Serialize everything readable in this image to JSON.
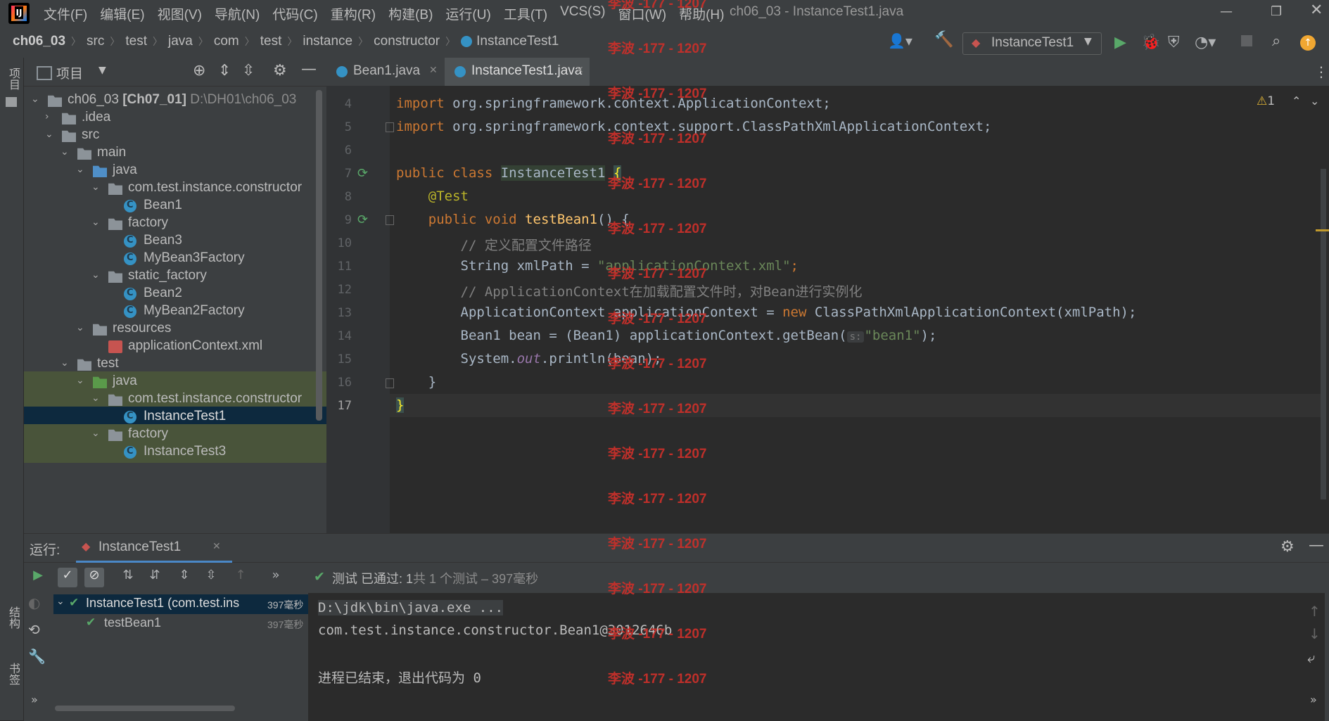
{
  "window_title": "ch06_03 - InstanceTest1.java",
  "menu": [
    "文件(F)",
    "编辑(E)",
    "视图(V)",
    "导航(N)",
    "代码(C)",
    "重构(R)",
    "构建(B)",
    "运行(U)",
    "工具(T)",
    "VCS(S)",
    "窗口(W)",
    "帮助(H)"
  ],
  "breadcrumb": [
    "ch06_03",
    "src",
    "test",
    "java",
    "com",
    "test",
    "instance",
    "constructor",
    "InstanceTest1"
  ],
  "run_config": "InstanceTest1",
  "left_strip": {
    "project": "项目",
    "structure": "结构",
    "bookmarks": "书签"
  },
  "project_panel": {
    "title": "项目"
  },
  "tree": [
    {
      "label": "ch06_03",
      "bold": "[Ch07_01]",
      "path": "D:\\DH01\\ch06_03"
    },
    {
      "label": ".idea"
    },
    {
      "label": "src"
    },
    {
      "label": "main"
    },
    {
      "label": "java"
    },
    {
      "label": "com.test.instance.constructor"
    },
    {
      "label": "Bean1"
    },
    {
      "label": "factory"
    },
    {
      "label": "Bean3"
    },
    {
      "label": "MyBean3Factory"
    },
    {
      "label": "static_factory"
    },
    {
      "label": "Bean2"
    },
    {
      "label": "MyBean2Factory"
    },
    {
      "label": "resources"
    },
    {
      "label": "applicationContext.xml"
    },
    {
      "label": "test"
    },
    {
      "label": "java"
    },
    {
      "label": "com.test.instance.constructor"
    },
    {
      "label": "InstanceTest1"
    },
    {
      "label": "factory"
    },
    {
      "label": "InstanceTest3"
    }
  ],
  "tabs": [
    {
      "label": "Bean1.java"
    },
    {
      "label": "InstanceTest1.java"
    }
  ],
  "warning_count": "1",
  "line_numbers": [
    "4",
    "5",
    "6",
    "7",
    "8",
    "9",
    "10",
    "11",
    "12",
    "13",
    "14",
    "15",
    "16",
    "17"
  ],
  "code": {
    "l4_kw": "import",
    "l4_rest": " org.springframework.context.ApplicationContext;",
    "l5_kw": "import",
    "l5_rest": " org.springframework.context.support.ClassPathXmlApplicationContext;",
    "l7_kw": "public class",
    "l7_cls": "InstanceTest1",
    "l7_brace": "{",
    "l8_ann": "@Test",
    "l9_kw": "public void",
    "l9_fn": "testBean1",
    "l9_rest": "() {",
    "l10": "// 定义配置文件路径",
    "l11_a": "String xmlPath = ",
    "l11_str": "\"applicationContext.xml\"",
    "l11_b": ";",
    "l12": "// ApplicationContext在加载配置文件时，对Bean进行实例化",
    "l13_a": "ApplicationContext applicationContext = ",
    "l13_kw": "new",
    "l13_b": " ClassPathXmlApplicationContext(xmlPath);",
    "l14_a": "Bean1 bean = (Bean1) applicationContext.getBean(",
    "l14_hint": "s:",
    "l14_str": "\"bean1\"",
    "l14_b": ");",
    "l15_a": "System.",
    "l15_it": "out",
    "l15_b": ".println(bean);",
    "l16": "}",
    "l17": "}"
  },
  "watermark": "李波 -177 - 1207",
  "run_panel": {
    "label": "运行:",
    "tab": "InstanceTest1",
    "status_prefix": "测试 已通过:",
    "status_count": " 1",
    "status_suffix": "共 1 个测试 – 397毫秒",
    "tests": [
      {
        "name": "InstanceTest1 (com.test.ins",
        "time": "397毫秒"
      },
      {
        "name": "testBean1",
        "time": "397毫秒"
      }
    ],
    "console": [
      "D:\\jdk\\bin\\java.exe ...",
      "com.test.instance.constructor.Bean1@3012646b",
      "",
      "进程已结束，退出代码为 0"
    ]
  }
}
